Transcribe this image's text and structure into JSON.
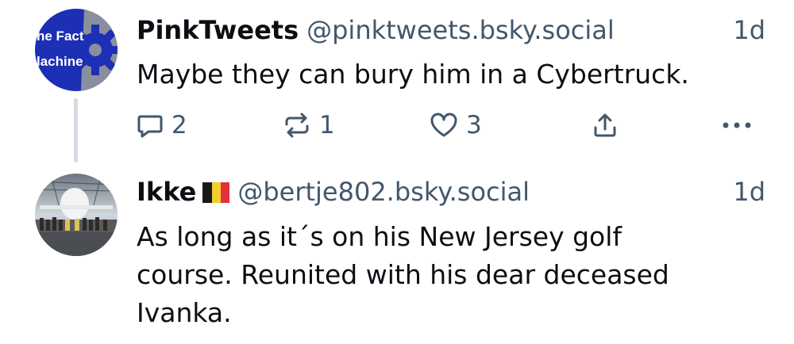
{
  "posts": [
    {
      "author_name": "PinkTweets",
      "handle": "@pinktweets.bsky.social",
      "time": "1d",
      "text": "Maybe they can bury him in a Cybertruck.",
      "avatar_text_line1": "he Fact",
      "avatar_text_line2": "lachine",
      "reply_count": "2",
      "repost_count": "1",
      "like_count": "3"
    },
    {
      "author_name": "Ikke",
      "flag": "belgium-flag",
      "handle": "@bertje802.bsky.social",
      "time": "1d",
      "text_lines": [
        "As long as it´s on his New Jersey golf",
        "course. Reunited with his dear deceased",
        "Ivanka."
      ]
    }
  ],
  "colors": {
    "text": "#0b0f14",
    "secondary": "#42576c",
    "thread_line": "#d4dbe2",
    "avatar_blue": "#1d2fb5"
  },
  "icons": [
    "reply-icon",
    "repost-icon",
    "like-icon",
    "share-icon",
    "more-icon"
  ]
}
